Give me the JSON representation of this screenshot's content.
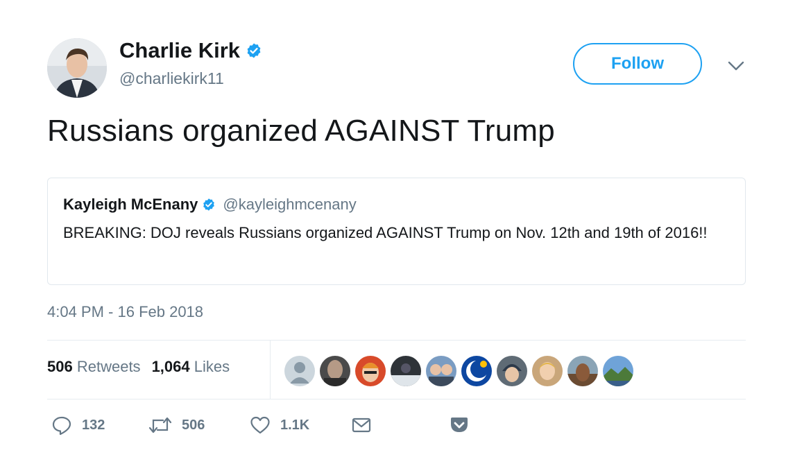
{
  "author": {
    "name": "Charlie Kirk",
    "handle": "@charliekirk11",
    "verified": true
  },
  "follow_label": "Follow",
  "tweet_text": "Russians organized AGAINST Trump",
  "quoted": {
    "name": "Kayleigh McEnany",
    "handle": "@kayleighmcenany",
    "verified": true,
    "text": "BREAKING: DOJ reveals Russians organized AGAINST Trump on Nov. 12th and 19th of 2016!!"
  },
  "timestamp": "4:04 PM - 16 Feb 2018",
  "stats": {
    "retweets_count": "506",
    "retweets_label": "Retweets",
    "likes_count": "1,064",
    "likes_label": "Likes"
  },
  "actions": {
    "replies": "132",
    "retweets": "506",
    "likes": "1.1K"
  },
  "icons": [
    "verified-badge-icon",
    "chevron-down-icon",
    "reply-icon",
    "retweet-icon",
    "heart-icon",
    "envelope-icon",
    "pocket-icon"
  ],
  "colors": {
    "accent": "#1da1f2",
    "muted": "#657786",
    "text": "#14171a",
    "border": "#e1e8ed"
  }
}
